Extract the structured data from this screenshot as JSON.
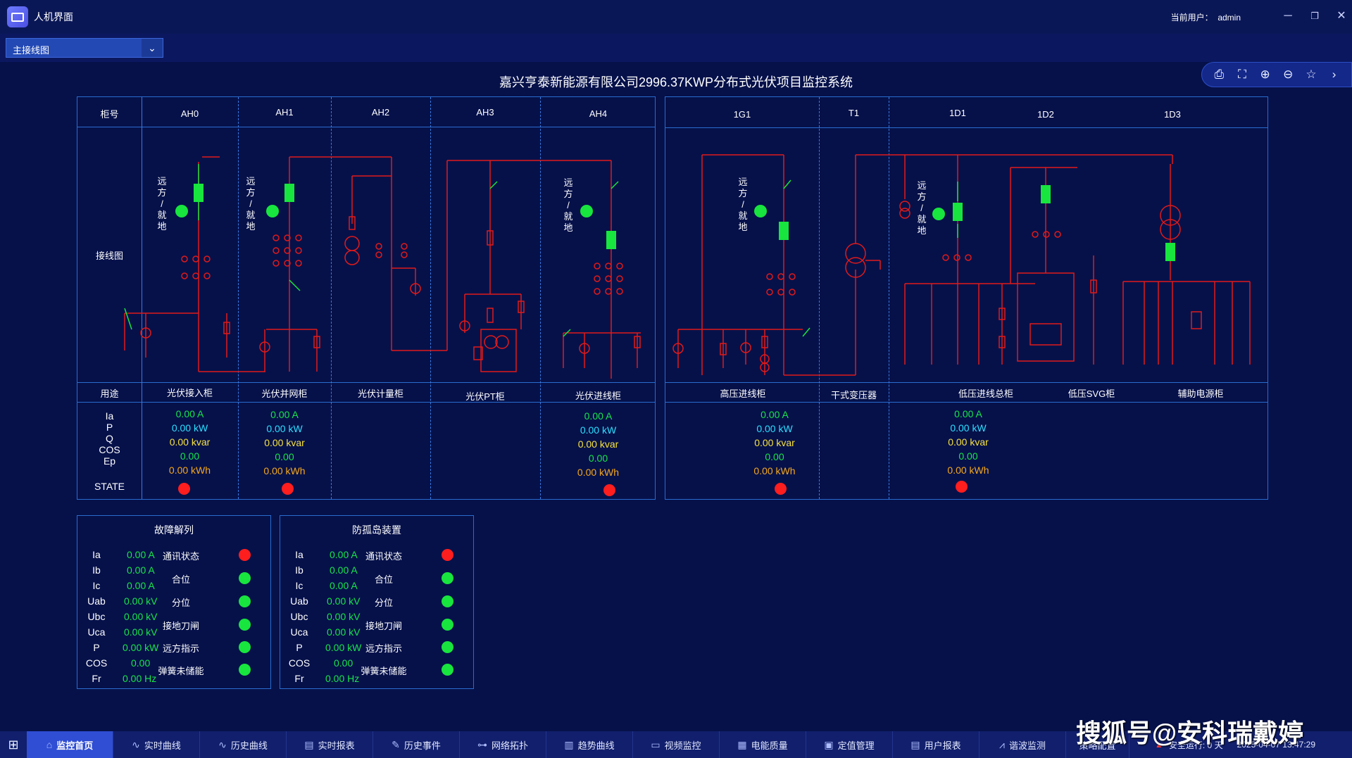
{
  "titlebar": {
    "title": "人机界面",
    "user_label": "当前用户：",
    "user": "admin"
  },
  "view_selector": {
    "value": "主接线图"
  },
  "page_title": "嘉兴亨泰新能源有限公司2996.37KWP分布式光伏项目监控系统",
  "row_labels": {
    "cabinet": "柜号",
    "diagram": "接线图",
    "usage": "用途",
    "state": "STATE"
  },
  "measure_labels": [
    "Ia",
    "P",
    "Q",
    "COS",
    "Ep"
  ],
  "remote_local": [
    "远",
    "方",
    "/",
    "就",
    "地"
  ],
  "left_cabinets": [
    {
      "id": "AH0",
      "usage": "光伏接入柜",
      "ia": "0.00 A",
      "p": "0.00 kW",
      "q": "0.00 kvar",
      "cos": "0.00",
      "ep": "0.00 kWh"
    },
    {
      "id": "AH1",
      "usage": "光伏并网柜",
      "ia": "0.00 A",
      "p": "0.00 kW",
      "q": "0.00 kvar",
      "cos": "0.00",
      "ep": "0.00 kWh"
    },
    {
      "id": "AH2",
      "usage": "光伏计量柜"
    },
    {
      "id": "AH3",
      "usage": "光伏PT柜"
    },
    {
      "id": "AH4",
      "usage": "光伏进线柜",
      "ia": "0.00 A",
      "p": "0.00 kW",
      "q": "0.00 kvar",
      "cos": "0.00",
      "ep": "0.00 kWh"
    }
  ],
  "right_cabinets": [
    {
      "id": "1G1",
      "usage": "高压进线柜",
      "ia": "0.00 A",
      "p": "0.00 kW",
      "q": "0.00 kvar",
      "cos": "0.00",
      "ep": "0.00 kWh"
    },
    {
      "id": "T1",
      "usage": "干式变压器"
    },
    {
      "id": "1D1",
      "usage": "低压进线总柜",
      "ia": "0.00 A",
      "p": "0.00 kW",
      "q": "0.00 kvar",
      "cos": "0.00",
      "ep": "0.00 kWh"
    },
    {
      "id": "1D2",
      "usage": "低压SVG柜"
    },
    {
      "id": "1D3",
      "usage": "辅助电源柜"
    }
  ],
  "fault_panel": {
    "title": "故障解列",
    "rows": [
      {
        "k": "Ia",
        "v": "0.00 A"
      },
      {
        "k": "Ib",
        "v": "0.00 A"
      },
      {
        "k": "Ic",
        "v": "0.00 A"
      },
      {
        "k": "Uab",
        "v": "0.00 kV"
      },
      {
        "k": "Ubc",
        "v": "0.00 kV"
      },
      {
        "k": "Uca",
        "v": "0.00 kV"
      },
      {
        "k": "P",
        "v": "0.00 kW"
      },
      {
        "k": "COS",
        "v": "0.00"
      },
      {
        "k": "Fr",
        "v": "0.00 Hz"
      }
    ],
    "status": [
      {
        "label": "通讯状态",
        "color": "red"
      },
      {
        "label": "合位",
        "color": "green"
      },
      {
        "label": "分位",
        "color": "green"
      },
      {
        "label": "接地刀闸",
        "color": "green"
      },
      {
        "label": "远方指示",
        "color": "green"
      },
      {
        "label": "弹簧未储能",
        "color": "green"
      }
    ]
  },
  "island_panel": {
    "title": "防孤岛装置",
    "rows": [
      {
        "k": "Ia",
        "v": "0.00 A"
      },
      {
        "k": "Ib",
        "v": "0.00 A"
      },
      {
        "k": "Ic",
        "v": "0.00 A"
      },
      {
        "k": "Uab",
        "v": "0.00 kV"
      },
      {
        "k": "Ubc",
        "v": "0.00 kV"
      },
      {
        "k": "Uca",
        "v": "0.00 kV"
      },
      {
        "k": "P",
        "v": "0.00 kW"
      },
      {
        "k": "COS",
        "v": "0.00"
      },
      {
        "k": "Fr",
        "v": "0.00 Hz"
      }
    ],
    "status": [
      {
        "label": "通讯状态",
        "color": "red"
      },
      {
        "label": "合位",
        "color": "green"
      },
      {
        "label": "分位",
        "color": "green"
      },
      {
        "label": "接地刀闸",
        "color": "green"
      },
      {
        "label": "远方指示",
        "color": "green"
      },
      {
        "label": "弹簧未储能",
        "color": "green"
      }
    ]
  },
  "taskbar": {
    "tabs": [
      "监控首页",
      "实时曲线",
      "历史曲线",
      "实时报表",
      "历史事件",
      "网络拓扑",
      "趋势曲线",
      "视频监控",
      "电能质量",
      "定值管理",
      "用户报表",
      "谐波监测",
      "策略配置"
    ],
    "safe_run": "安全运行: 0 天",
    "datetime": "2025-04-07 13:47:29"
  },
  "watermark": "搜狐号@安科瑞戴婷",
  "colors": {
    "bg": "#06114a",
    "line": "#2a6ccf",
    "wire": "#e01a1a",
    "on": "#18e53e",
    "off": "#ff1e1e"
  }
}
